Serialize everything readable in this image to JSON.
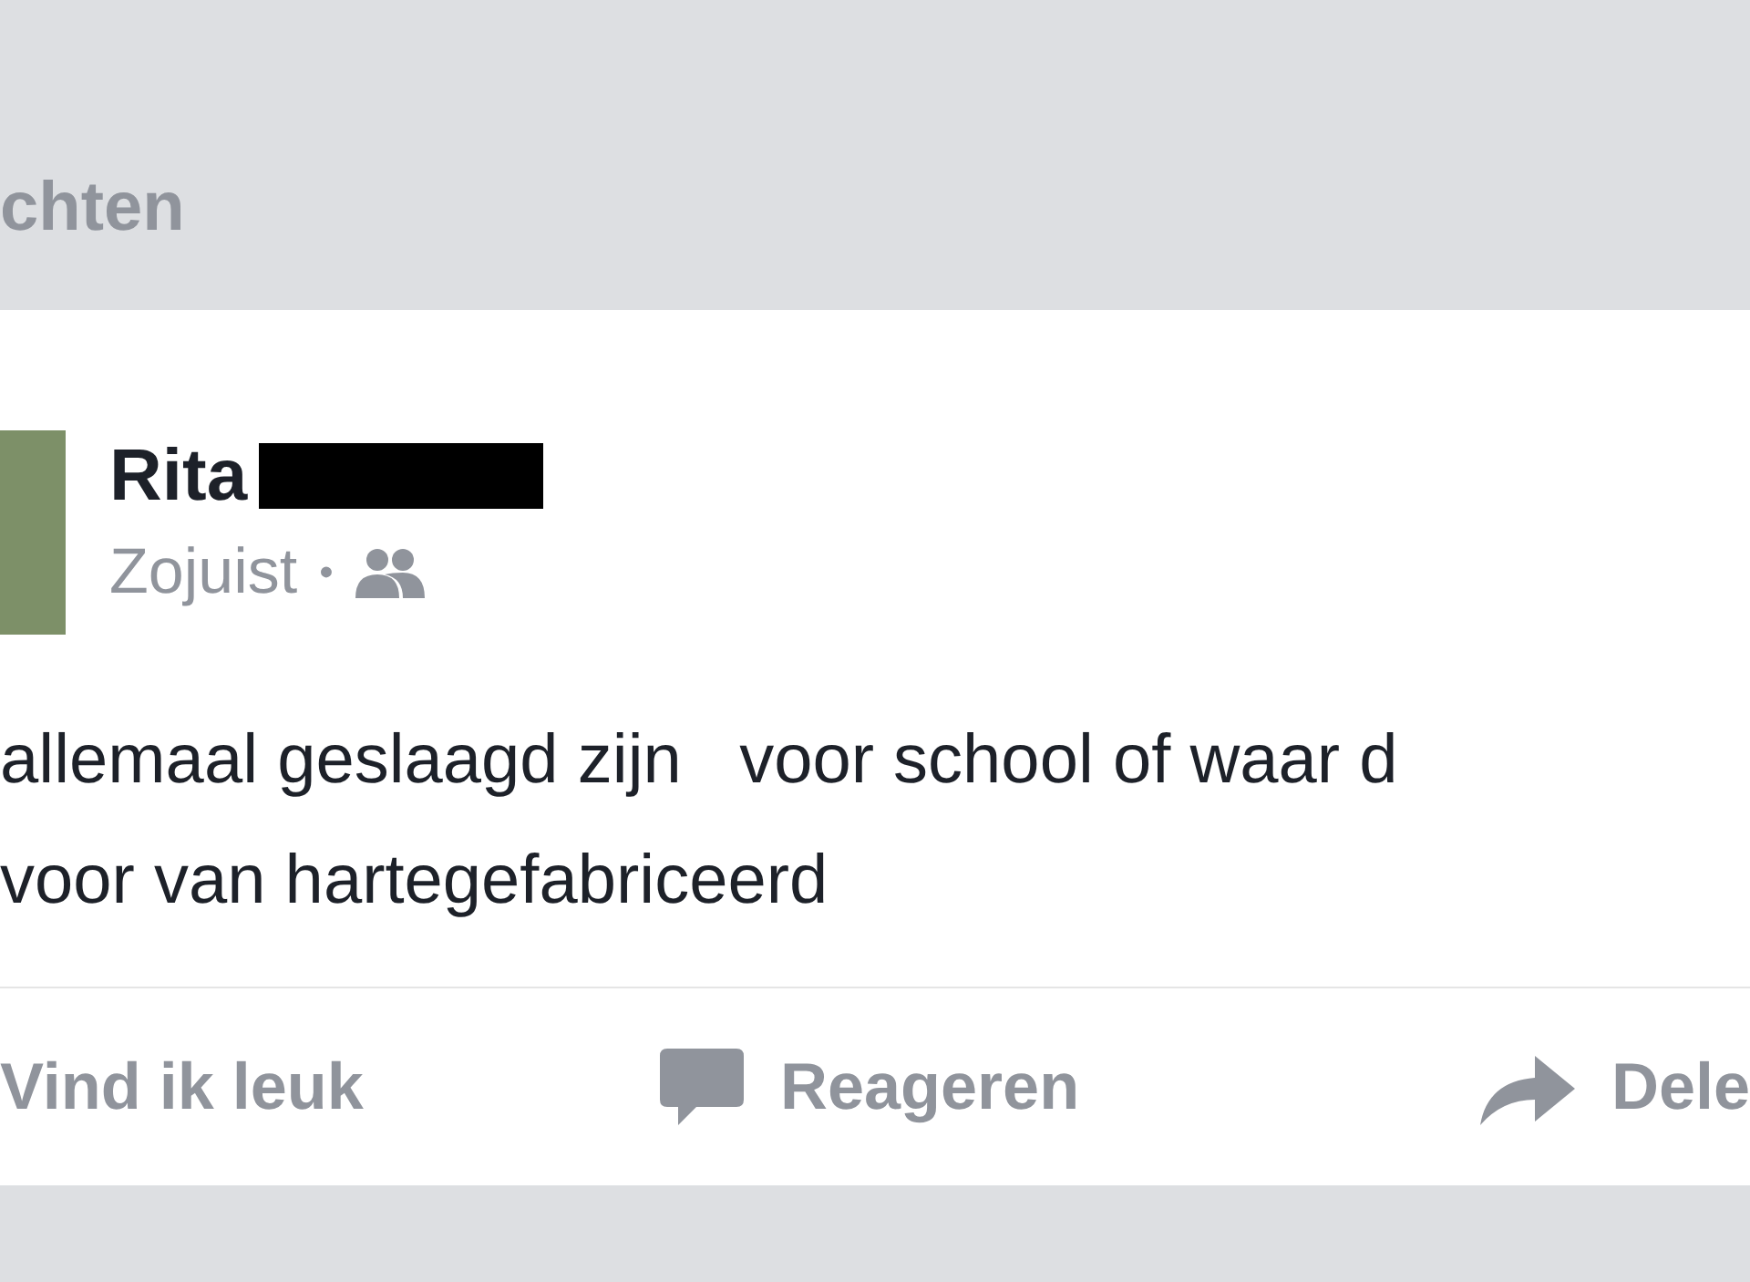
{
  "section_title": "chten",
  "post": {
    "author": "Rita",
    "time": "Zojuist",
    "separator": "•",
    "lines": [
      "allemaal geslaagd zijn   voor school of waar d",
      "voor van hartegefabriceerd"
    ],
    "actions": [
      {
        "kind": "like",
        "label": "Vind ik leuk"
      },
      {
        "kind": "comment",
        "label": "Reageren"
      },
      {
        "kind": "share",
        "label": "Dele"
      }
    ]
  }
}
